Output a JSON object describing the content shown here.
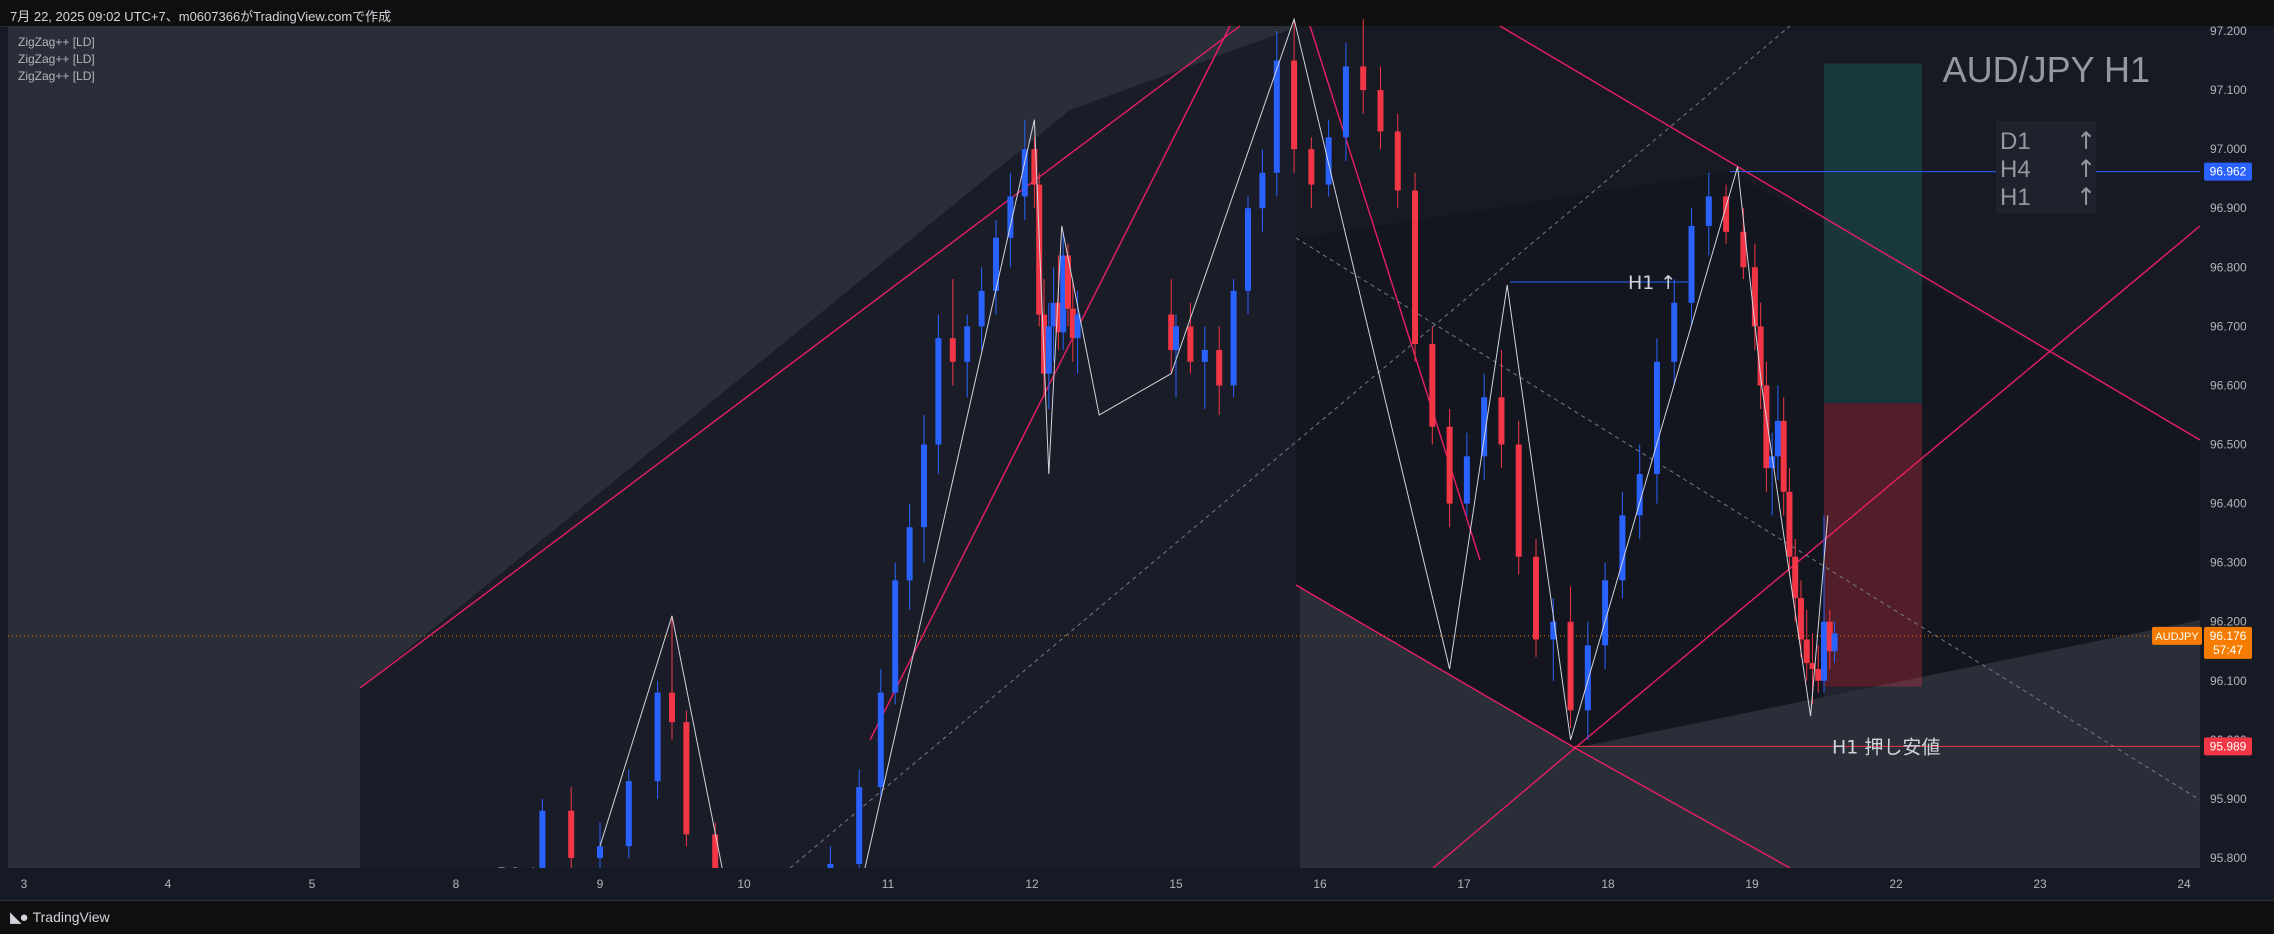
{
  "header": {
    "snapshot_text": "7月 22, 2025 09:02 UTC+7、m0607366がTradingView.comで作成"
  },
  "indicators": [
    "ZigZag++ [LD]",
    "ZigZag++ [LD]",
    "ZigZag++ [LD]"
  ],
  "footer": {
    "brand": "TradingView",
    "logo_icon": "tradingview-logo-icon"
  },
  "colors": {
    "background": "#161a25",
    "up_candle": "#2962ff",
    "down_candle": "#f23645",
    "channel": "#e91e63",
    "price_line": "#f57c00",
    "resistance_label": "#2962ff",
    "support_label": "#f23645"
  },
  "chart_data": {
    "type": "candlestick",
    "title": "AUD/JPY H1",
    "symbol": "AUDJPY",
    "ylim": [
      95.77,
      97.21
    ],
    "y_ticks": [
      "97.200",
      "97.100",
      "97.000",
      "96.900",
      "96.800",
      "96.700",
      "96.600",
      "96.500",
      "96.400",
      "96.300",
      "96.200",
      "96.100",
      "96.000",
      "95.900",
      "95.800"
    ],
    "x_ticks": [
      "3",
      "4",
      "5",
      "8",
      "9",
      "10",
      "11",
      "12",
      "15",
      "16",
      "17",
      "18",
      "19",
      "22",
      "23",
      "24"
    ],
    "trend_table": [
      {
        "tf": "D1",
        "dir": "↑"
      },
      {
        "tf": "H4",
        "dir": "↑"
      },
      {
        "tf": "H1",
        "dir": "↑"
      }
    ],
    "annotations": [
      {
        "text": "H1 ↑",
        "price": 96.775
      },
      {
        "text": "H1 押し安値",
        "price": 95.989
      },
      {
        "text": "D1 ↑",
        "price": 95.77
      }
    ],
    "price_labels": [
      {
        "value": "96.962",
        "kind": "resistance"
      },
      {
        "value": "95.989",
        "kind": "support"
      }
    ],
    "current_price": {
      "symbol": "AUDJPY",
      "value": "96.176",
      "countdown": "57:47"
    },
    "horizontal_levels": [
      96.962,
      95.989,
      96.176
    ],
    "position": {
      "entry": 96.57,
      "target": 97.145,
      "stop": 96.09
    },
    "candles_approx": [
      [
        8.6,
        95.7,
        95.9,
        95.65,
        95.88
      ],
      [
        8.8,
        95.88,
        95.92,
        95.78,
        95.8
      ],
      [
        9.0,
        95.8,
        95.86,
        95.74,
        95.82
      ],
      [
        9.2,
        95.82,
        95.95,
        95.8,
        95.93
      ],
      [
        9.4,
        95.93,
        96.1,
        95.9,
        96.08
      ],
      [
        9.5,
        96.08,
        96.21,
        96.0,
        96.03
      ],
      [
        9.6,
        96.03,
        96.05,
        95.82,
        95.84
      ],
      [
        9.8,
        95.84,
        95.86,
        95.7,
        95.72
      ],
      [
        10.4,
        95.7,
        95.76,
        95.66,
        95.74
      ],
      [
        10.6,
        95.74,
        95.82,
        95.7,
        95.79
      ],
      [
        10.8,
        95.79,
        95.95,
        95.76,
        95.92
      ],
      [
        10.95,
        95.92,
        96.12,
        95.9,
        96.08
      ],
      [
        11.05,
        96.08,
        96.3,
        96.06,
        96.27
      ],
      [
        11.15,
        96.27,
        96.4,
        96.22,
        96.36
      ],
      [
        11.25,
        96.36,
        96.55,
        96.3,
        96.5
      ],
      [
        11.35,
        96.5,
        96.72,
        96.45,
        96.68
      ],
      [
        11.45,
        96.68,
        96.78,
        96.6,
        96.64
      ],
      [
        11.55,
        96.64,
        96.72,
        96.58,
        96.7
      ],
      [
        11.65,
        96.7,
        96.8,
        96.66,
        96.76
      ],
      [
        11.75,
        96.76,
        96.88,
        96.72,
        96.85
      ],
      [
        11.85,
        96.85,
        96.96,
        96.8,
        96.92
      ],
      [
        11.95,
        96.92,
        97.05,
        96.88,
        97.0
      ],
      [
        12.05,
        97.0,
        97.02,
        96.9,
        96.94
      ],
      [
        12.15,
        96.94,
        96.96,
        96.7,
        96.72
      ],
      [
        12.25,
        96.72,
        96.78,
        96.58,
        96.62
      ],
      [
        12.35,
        96.62,
        96.74,
        96.56,
        96.7
      ],
      [
        12.45,
        96.7,
        96.8,
        96.64,
        96.74
      ],
      [
        12.55,
        96.74,
        96.82,
        96.66,
        96.69
      ],
      [
        12.65,
        96.69,
        96.86,
        96.66,
        96.82
      ],
      [
        12.75,
        96.82,
        96.84,
        96.7,
        96.73
      ],
      [
        12.85,
        96.73,
        96.78,
        96.64,
        96.68
      ],
      [
        12.95,
        96.68,
        96.76,
        96.62,
        96.72
      ],
      [
        14.9,
        96.72,
        96.78,
        96.62,
        96.66
      ],
      [
        15.0,
        96.66,
        96.72,
        96.58,
        96.7
      ],
      [
        15.1,
        96.7,
        96.74,
        96.62,
        96.64
      ],
      [
        15.2,
        96.64,
        96.7,
        96.56,
        96.66
      ],
      [
        15.3,
        96.66,
        96.7,
        96.55,
        96.6
      ],
      [
        15.4,
        96.6,
        96.78,
        96.58,
        96.76
      ],
      [
        15.5,
        96.76,
        96.92,
        96.72,
        96.9
      ],
      [
        15.6,
        96.9,
        97.0,
        96.86,
        96.96
      ],
      [
        15.7,
        96.96,
        97.2,
        96.92,
        97.15
      ],
      [
        15.82,
        97.15,
        97.22,
        96.96,
        97.0
      ],
      [
        15.94,
        97.0,
        97.02,
        96.9,
        96.94
      ],
      [
        16.06,
        96.94,
        97.05,
        96.92,
        97.02
      ],
      [
        16.18,
        97.02,
        97.18,
        96.98,
        97.14
      ],
      [
        16.3,
        97.14,
        97.22,
        97.06,
        97.1
      ],
      [
        16.42,
        97.1,
        97.14,
        97.0,
        97.03
      ],
      [
        16.54,
        97.03,
        97.06,
        96.9,
        96.93
      ],
      [
        16.66,
        96.93,
        96.96,
        96.64,
        96.67
      ],
      [
        16.78,
        96.67,
        96.7,
        96.5,
        96.53
      ],
      [
        16.9,
        96.53,
        96.56,
        96.36,
        96.4
      ],
      [
        17.02,
        96.4,
        96.52,
        96.38,
        96.48
      ],
      [
        17.14,
        96.48,
        96.62,
        96.44,
        96.58
      ],
      [
        17.26,
        96.58,
        96.66,
        96.46,
        96.5
      ],
      [
        17.38,
        96.5,
        96.54,
        96.28,
        96.31
      ],
      [
        17.5,
        96.31,
        96.34,
        96.14,
        96.17
      ],
      [
        17.62,
        96.17,
        96.24,
        96.1,
        96.2
      ],
      [
        17.74,
        96.2,
        96.26,
        96.02,
        96.05
      ],
      [
        17.86,
        96.05,
        96.2,
        96.0,
        96.16
      ],
      [
        17.98,
        96.16,
        96.3,
        96.12,
        96.27
      ],
      [
        18.1,
        96.27,
        96.42,
        96.24,
        96.38
      ],
      [
        18.22,
        96.38,
        96.5,
        96.34,
        96.45
      ],
      [
        18.34,
        96.45,
        96.68,
        96.4,
        96.64
      ],
      [
        18.46,
        96.64,
        96.78,
        96.6,
        96.74
      ],
      [
        18.58,
        96.74,
        96.9,
        96.7,
        96.87
      ],
      [
        18.7,
        96.87,
        96.96,
        96.82,
        96.92
      ],
      [
        18.82,
        96.92,
        96.94,
        96.84,
        96.86
      ],
      [
        18.94,
        96.86,
        96.9,
        96.78,
        96.8
      ],
      [
        19.06,
        96.8,
        96.84,
        96.66,
        96.7
      ],
      [
        19.18,
        96.7,
        96.74,
        96.56,
        96.6
      ],
      [
        19.3,
        96.6,
        96.64,
        96.42,
        96.46
      ],
      [
        19.42,
        96.46,
        96.52,
        96.38,
        96.48
      ],
      [
        19.54,
        96.48,
        96.6,
        96.44,
        96.54
      ],
      [
        19.66,
        96.54,
        96.58,
        96.38,
        96.42
      ],
      [
        19.78,
        96.42,
        96.46,
        96.28,
        96.31
      ],
      [
        19.9,
        96.31,
        96.34,
        96.2,
        96.24
      ],
      [
        20.02,
        96.24,
        96.27,
        96.14,
        96.17
      ],
      [
        20.14,
        96.17,
        96.22,
        96.1,
        96.13
      ],
      [
        20.26,
        96.13,
        96.18,
        96.06,
        96.12
      ],
      [
        20.38,
        96.12,
        96.16,
        96.08,
        96.1
      ],
      [
        20.5,
        96.1,
        96.38,
        96.08,
        96.2
      ],
      [
        20.62,
        96.2,
        96.22,
        96.12,
        96.15
      ],
      [
        20.72,
        96.15,
        96.2,
        96.13,
        96.18
      ]
    ],
    "grid": false,
    "legend": "top-left"
  }
}
